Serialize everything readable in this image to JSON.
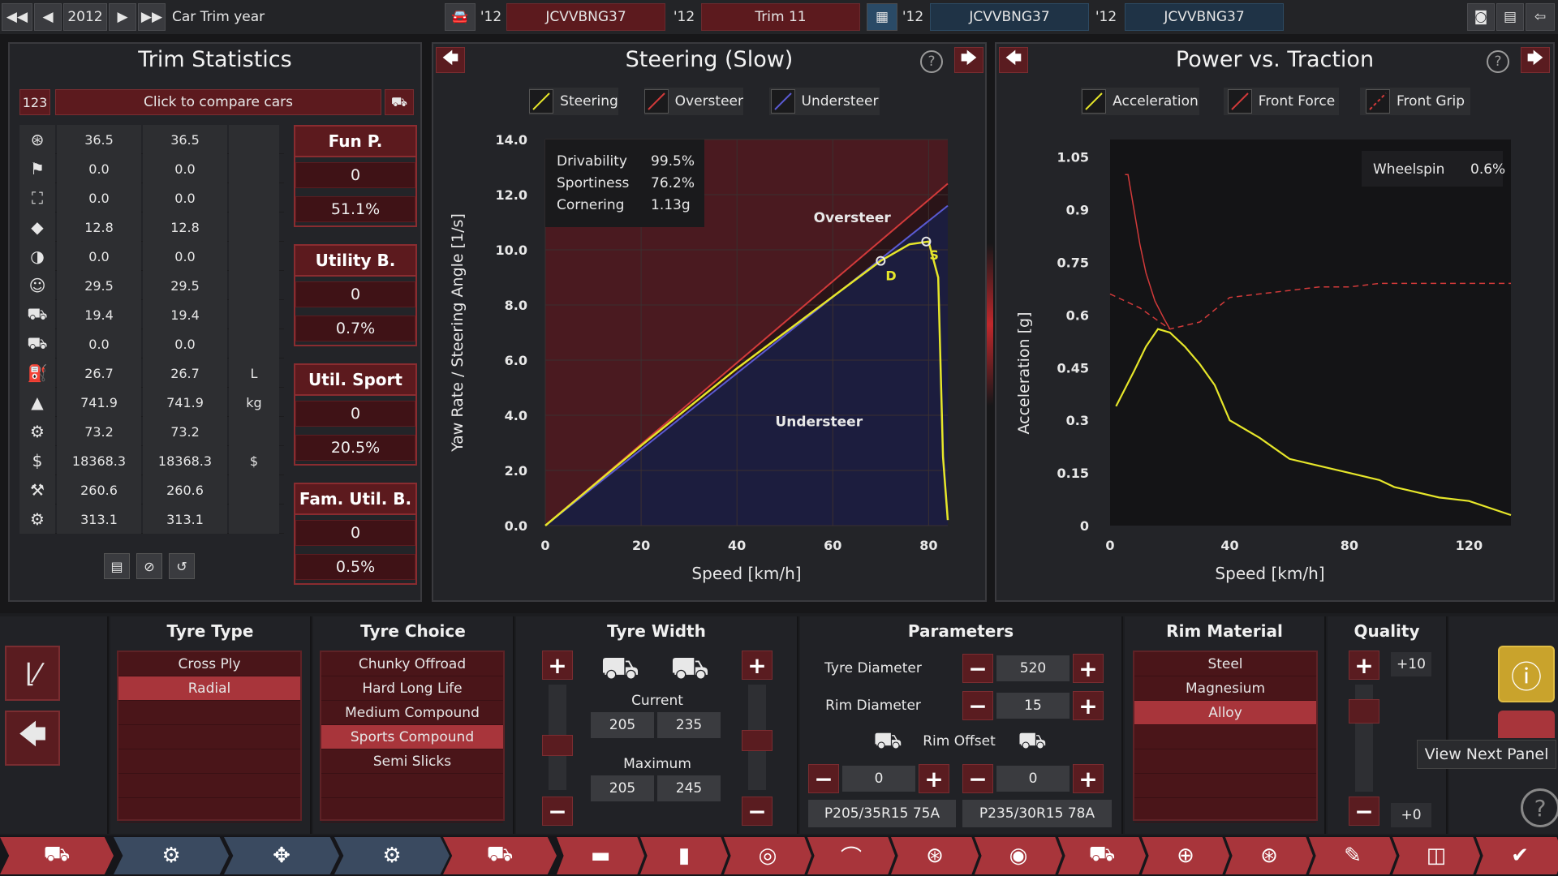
{
  "topbar": {
    "year": "2012",
    "title": "Car Trim year",
    "slots": [
      {
        "year": "'12",
        "label": "JCVVBNG37"
      },
      {
        "year": "'12",
        "label": "Trim 11"
      },
      {
        "year": "'12",
        "label": "JCVVBNG37"
      },
      {
        "year": "'12",
        "label": "JCVVBNG37"
      }
    ]
  },
  "trim": {
    "title": "Trim Statistics",
    "badge": "123",
    "compare": "Click to compare cars",
    "rows": [
      {
        "icon": "steering-wheel-icon",
        "a": "36.5",
        "b": "36.5",
        "u": ""
      },
      {
        "icon": "race-flag-icon",
        "a": "0.0",
        "b": "0.0",
        "u": ""
      },
      {
        "icon": "seat-icon",
        "a": "0.0",
        "b": "0.0",
        "u": ""
      },
      {
        "icon": "diamond-icon",
        "a": "12.8",
        "b": "12.8",
        "u": ""
      },
      {
        "icon": "safety-icon",
        "a": "0.0",
        "b": "0.0",
        "u": ""
      },
      {
        "icon": "passengers-icon",
        "a": "29.5",
        "b": "29.5",
        "u": ""
      },
      {
        "icon": "cargo-car-icon",
        "a": "19.4",
        "b": "19.4",
        "u": ""
      },
      {
        "icon": "offroad-car-icon",
        "a": "0.0",
        "b": "0.0",
        "u": ""
      },
      {
        "icon": "fuel-icon",
        "a": "26.7",
        "b": "26.7",
        "u": "L"
      },
      {
        "icon": "weight-icon",
        "a": "741.9",
        "b": "741.9",
        "u": "kg"
      },
      {
        "icon": "service-icon",
        "a": "73.2",
        "b": "73.2",
        "u": ""
      },
      {
        "icon": "cost-icon",
        "a": "18368.3",
        "b": "18368.3",
        "u": "$"
      },
      {
        "icon": "production-icon",
        "a": "260.6",
        "b": "260.6",
        "u": ""
      },
      {
        "icon": "engineering-icon",
        "a": "313.1",
        "b": "313.1",
        "u": ""
      }
    ],
    "categories": [
      {
        "name": "Fun P.",
        "value": "0",
        "pct": "51.1%"
      },
      {
        "name": "Utility B.",
        "value": "0",
        "pct": "0.7%"
      },
      {
        "name": "Util. Sport",
        "value": "0",
        "pct": "20.5%"
      },
      {
        "name": "Fam. Util. B.",
        "value": "0",
        "pct": "0.5%"
      }
    ]
  },
  "steering": {
    "title": "Steering (Slow)",
    "help": "?",
    "legend": [
      "Steering",
      "Oversteer",
      "Understeer"
    ],
    "info": [
      {
        "k": "Drivability",
        "v": "99.5%"
      },
      {
        "k": "Sportiness",
        "v": "76.2%"
      },
      {
        "k": "Cornering",
        "v": "1.13g"
      }
    ],
    "over_label": "Oversteer",
    "under_label": "Understeer",
    "d_label": "D",
    "s_label": "S",
    "ylabel": "Yaw Rate / Steering Angle [1/s]",
    "xlabel": "Speed [km/h]",
    "yticks": [
      "14.0",
      "12.0",
      "10.0",
      "8.0",
      "6.0",
      "4.0",
      "2.0",
      "0.0"
    ],
    "xticks": [
      "0",
      "20",
      "40",
      "60",
      "80"
    ]
  },
  "power": {
    "title": "Power vs. Traction",
    "help": "?",
    "legend": [
      "Acceleration",
      "Front Force",
      "Front Grip"
    ],
    "wheelspin_label": "Wheelspin",
    "wheelspin_value": "0.6%",
    "ylabel": "Acceleration [g]",
    "xlabel": "Speed [km/h]",
    "yticks": [
      "1.05",
      "0.9",
      "0.75",
      "0.6",
      "0.45",
      "0.3",
      "0.15",
      "0"
    ],
    "xticks": [
      "0",
      "40",
      "80",
      "120"
    ]
  },
  "chart_data": [
    {
      "type": "line",
      "title": "Steering (Slow)",
      "xlabel": "Speed [km/h]",
      "ylabel": "Yaw Rate / Steering Angle [1/s]",
      "xlim": [
        0,
        84
      ],
      "ylim": [
        0,
        14
      ],
      "series": [
        {
          "name": "Steering",
          "x": [
            0,
            10,
            20,
            30,
            40,
            50,
            60,
            70,
            76,
            80,
            82,
            83,
            84
          ],
          "y": [
            0,
            1.45,
            2.9,
            4.3,
            5.7,
            7.0,
            8.3,
            9.6,
            10.2,
            10.3,
            9.0,
            2.5,
            0.2
          ]
        },
        {
          "name": "Oversteer",
          "x": [
            0,
            84
          ],
          "y": [
            0,
            12.4
          ]
        },
        {
          "name": "Understeer",
          "x": [
            0,
            84
          ],
          "y": [
            0,
            11.6
          ]
        }
      ],
      "markers": [
        {
          "label": "D",
          "x": 70,
          "y": 9.6
        },
        {
          "label": "S",
          "x": 79.5,
          "y": 10.3
        }
      ],
      "annotations": [
        "Oversteer",
        "Understeer",
        "Drivability 99.5%",
        "Sportiness 76.2%",
        "Cornering 1.13g"
      ]
    },
    {
      "type": "line",
      "title": "Power vs. Traction",
      "xlabel": "Speed [km/h]",
      "ylabel": "Acceleration [g]",
      "xlim": [
        0,
        134
      ],
      "ylim": [
        0,
        1.1
      ],
      "series": [
        {
          "name": "Acceleration",
          "x": [
            2,
            8,
            12,
            16,
            20,
            25,
            30,
            35,
            40,
            50,
            55,
            60,
            70,
            80,
            90,
            95,
            100,
            110,
            120,
            134
          ],
          "y": [
            0.34,
            0.44,
            0.51,
            0.56,
            0.55,
            0.51,
            0.46,
            0.4,
            0.3,
            0.25,
            0.22,
            0.19,
            0.17,
            0.15,
            0.13,
            0.11,
            0.1,
            0.08,
            0.07,
            0.03
          ]
        },
        {
          "name": "Front Force",
          "x": [
            5,
            6,
            8,
            10,
            12,
            15,
            18,
            20
          ],
          "y": [
            1.0,
            1.0,
            0.9,
            0.8,
            0.72,
            0.64,
            0.59,
            0.56
          ]
        },
        {
          "name": "Front Grip",
          "x": [
            0,
            10,
            20,
            30,
            40,
            50,
            60,
            70,
            80,
            90,
            100,
            110,
            120,
            134
          ],
          "y": [
            0.66,
            0.62,
            0.56,
            0.58,
            0.65,
            0.66,
            0.67,
            0.68,
            0.68,
            0.69,
            0.69,
            0.69,
            0.69,
            0.69
          ]
        }
      ],
      "annotations": [
        "Wheelspin 0.6%"
      ]
    }
  ],
  "bottom": {
    "tyre_type": {
      "title": "Tyre Type",
      "items": [
        "Cross Ply",
        "Radial"
      ],
      "selected": 1
    },
    "tyre_choice": {
      "title": "Tyre Choice",
      "items": [
        "Chunky Offroad",
        "Hard Long Life",
        "Medium Compound",
        "Sports Compound",
        "Semi Slicks"
      ],
      "selected": 3
    },
    "tyre_width": {
      "title": "Tyre Width",
      "current_label": "Current",
      "maximum_label": "Maximum",
      "cur_front": "205",
      "cur_rear": "235",
      "max_front": "205",
      "max_rear": "245"
    },
    "params": {
      "title": "Parameters",
      "tyre_diameter_label": "Tyre Diameter",
      "tyre_diameter": "520",
      "rim_diameter_label": "Rim Diameter",
      "rim_diameter": "15",
      "rim_offset_label": "Rim Offset",
      "offset_front": "0",
      "offset_rear": "0",
      "code_front": "P205/35R15 75A",
      "code_rear": "P235/30R15 78A"
    },
    "rim": {
      "title": "Rim Material",
      "items": [
        "Steel",
        "Magnesium",
        "Alloy"
      ],
      "selected": 2
    },
    "quality": {
      "title": "Quality",
      "top": "+10",
      "bottom": "+0"
    },
    "tooltip": "View Next Panel"
  },
  "colors": {
    "accent": "#a8353b",
    "steering": "#e6e62a",
    "oversteer": "#d23a3a",
    "understeer": "#5a5ad2"
  }
}
